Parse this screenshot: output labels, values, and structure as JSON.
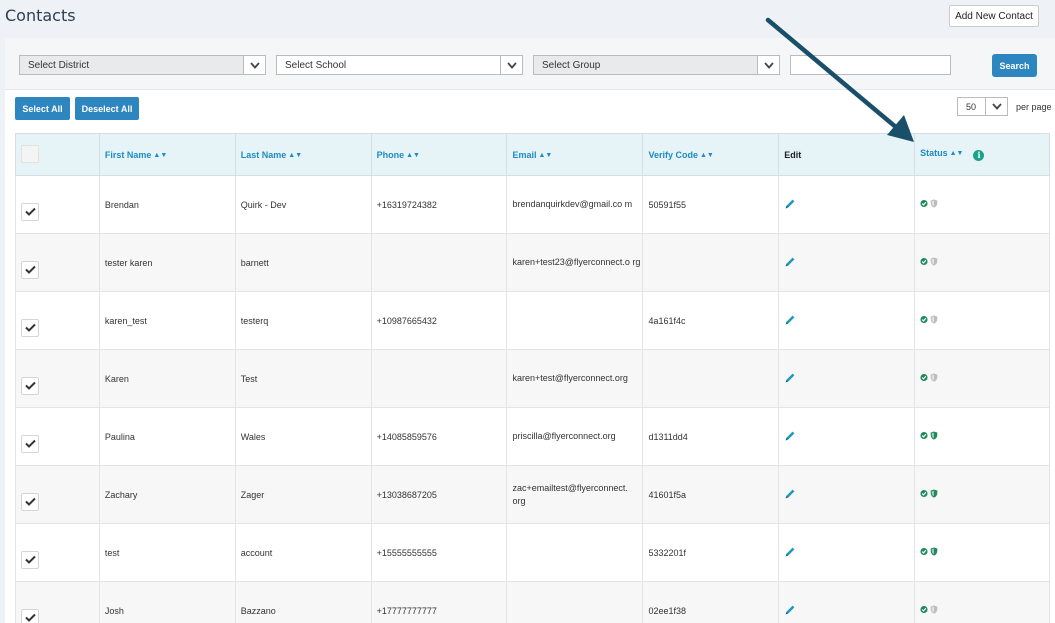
{
  "page": {
    "title": "Contacts",
    "add_contact_label": "Add New Contact"
  },
  "filters": {
    "district": "Select District",
    "school": "Select School",
    "group": "Select Group",
    "search_value": "",
    "search_label": "Search"
  },
  "actions": {
    "select_all": "Select All",
    "deselect_all": "Deselect All"
  },
  "pagination": {
    "per_page_value": "50",
    "per_page_label": "per page"
  },
  "table": {
    "columns": [
      "First Name",
      "Last Name",
      "Phone",
      "Email",
      "Verify Code",
      "Edit",
      "Status"
    ],
    "rows": [
      {
        "first": "Brendan",
        "last": "Quirk - Dev",
        "phone": "+16319724382",
        "email": "brendanquirkdev@gmail.co m",
        "code": "50591f55",
        "verified": false
      },
      {
        "first": "tester karen",
        "last": "barnett",
        "phone": "",
        "email": "karen+test23@flyerconnect.o rg",
        "code": "",
        "verified": false
      },
      {
        "first": "karen_test",
        "last": "testerq",
        "phone": "+10987665432",
        "email": "",
        "code": "4a161f4c",
        "verified": false
      },
      {
        "first": "Karen",
        "last": "Test",
        "phone": "",
        "email": "karen+test@flyerconnect.org",
        "code": "",
        "verified": false
      },
      {
        "first": "Paulina",
        "last": "Wales",
        "phone": "+14085859576",
        "email": "priscilla@flyerconnect.org",
        "code": "d1311dd4",
        "verified": true
      },
      {
        "first": "Zachary",
        "last": "Zager",
        "phone": "+13038687205",
        "email": "zac+emailtest@flyerconnect. org",
        "code": "41601f5a",
        "verified": true
      },
      {
        "first": "test",
        "last": "account",
        "phone": "+15555555555",
        "email": "",
        "code": "5332201f",
        "verified": true
      },
      {
        "first": "Josh",
        "last": "Bazzano",
        "phone": "+17777777777",
        "email": "",
        "code": "02ee1f38",
        "verified": false
      }
    ]
  },
  "colors": {
    "accent": "#2e86c1",
    "header_text": "#1e8bc3",
    "status_green": "#1d8a5c",
    "arrow": "#1a4f6a"
  },
  "icons": {
    "edit": "pencil-icon",
    "status_ok": "check-circle-icon",
    "status_shield": "shield-icon",
    "info": "info-icon"
  }
}
